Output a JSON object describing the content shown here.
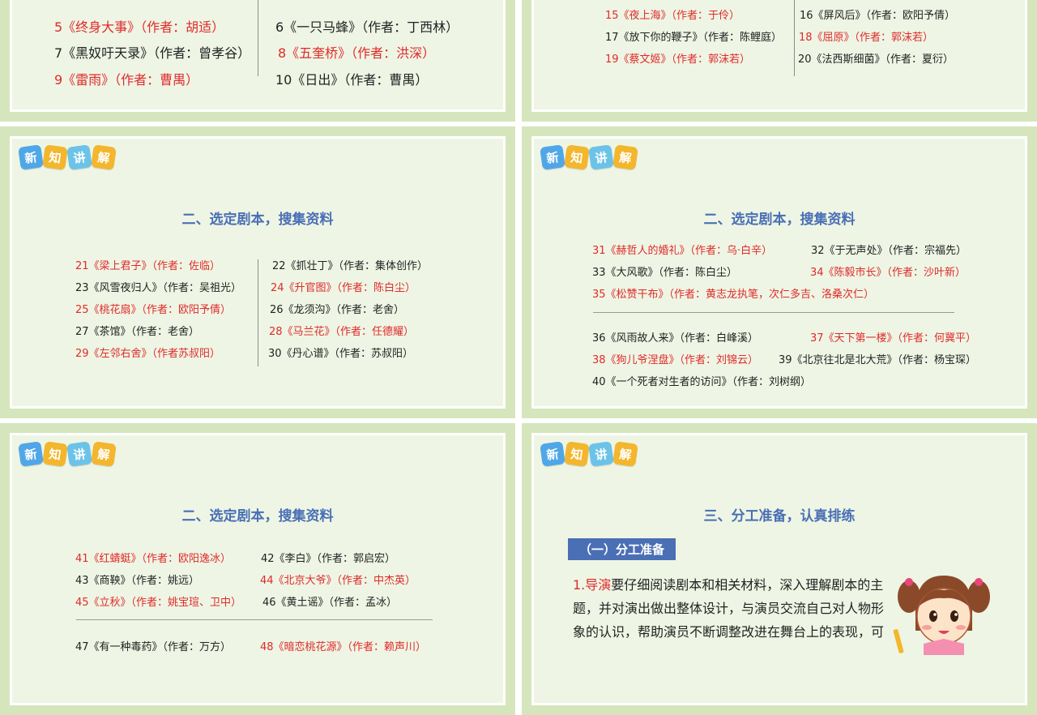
{
  "badge": {
    "chars": [
      "新",
      "知",
      "讲",
      "解"
    ],
    "colors": [
      "#4fa7e8",
      "#f3b62c",
      "#6cc3e8",
      "#f3b62c"
    ]
  },
  "slide1": {
    "left": [
      {
        "text": "5《终身大事》（作者：胡适）",
        "red": true
      },
      {
        "text": "7《黑奴吁天录》（作者：曾孝谷）",
        "red": false
      },
      {
        "text": "9《雷雨》（作者：曹禺）",
        "red": true
      }
    ],
    "right": [
      {
        "text": "6《一只马蜂》（作者：丁西林）",
        "red": false
      },
      {
        "text": "8《五奎桥》（作者：洪深）",
        "red": true
      },
      {
        "text": "10《日出》（作者：曹禺）",
        "red": false
      }
    ]
  },
  "slide2": {
    "left": [
      {
        "text": "15《夜上海》（作者：于伶）",
        "red": true
      },
      {
        "text": "17《放下你的鞭子》（作者：陈鲤庭）",
        "red": false
      },
      {
        "text": "19《蔡文姬》（作者：郭沫若）",
        "red": true
      }
    ],
    "right": [
      {
        "text": "16《屏风后》（作者：欧阳予倩）",
        "red": false
      },
      {
        "text": "18《屈原》（作者：郭沫若）",
        "red": true
      },
      {
        "text": "20《法西斯细菌》（作者：夏衍）",
        "red": false
      }
    ]
  },
  "slide3": {
    "title": "二、选定剧本，搜集资料",
    "left": [
      {
        "text": "21《梁上君子》（作者：佐临）",
        "red": true
      },
      {
        "text": "23《风雪夜归人》（作者：吴祖光）",
        "red": false
      },
      {
        "text": "25《桃花扇》（作者：欧阳予倩）",
        "red": true
      },
      {
        "text": "27《茶馆》（作者：老舍）",
        "red": false
      },
      {
        "text": "29《左邻右舍》（作者苏叔阳）",
        "red": true
      }
    ],
    "right": [
      {
        "text": "22《抓壮丁》（作者：集体创作）",
        "red": false
      },
      {
        "text": "24《升官图》（作者：陈白尘）",
        "red": true
      },
      {
        "text": "26《龙须沟》（作者：老舍）",
        "red": false
      },
      {
        "text": "28《马兰花》（作者：任德耀）",
        "red": true
      },
      {
        "text": "30《丹心谱》（作者：苏叔阳）",
        "red": false
      }
    ]
  },
  "slide4": {
    "title": "二、选定剧本，搜集资料",
    "r31": "31《赫哲人的婚礼》（作者：乌·白辛）",
    "r32": "32《于无声处》（作者：宗福先）",
    "r33": "33《大风歌》（作者：陈白尘）",
    "r34": "34《陈毅市长》（作者：沙叶新）",
    "r35": "35《松赞干布》（作者：黄志龙执笔，次仁多吉、洛桑次仁）",
    "r36": "36《风雨故人来》（作者：白峰溪）",
    "r37": "37《天下第一楼》（作者：何冀平）",
    "r38": "38《狗儿爷涅盘》（作者：刘锦云）",
    "r39": "39《北京往北是北大荒》（作者：杨宝琛）",
    "r40": "40《一个死者对生者的访问》（作者：刘树纲）"
  },
  "slide5": {
    "title": "二、选定剧本，搜集资料",
    "r41": "41《红蜻蜓》（作者：欧阳逸冰）",
    "r42": "42《李白》（作者：郭启宏）",
    "r43": "43《商鞅》（作者：姚远）",
    "r44": "44《北京大爷》（作者：中杰英）",
    "r45": "45《立秋》（作者：姚宝瑄、卫中）",
    "r46": "46《黄土谣》（作者：孟冰）",
    "r47": "47《有一种毒药》（作者：万方）",
    "r48": "48《暗恋桃花源》（作者：赖声川）"
  },
  "slide6": {
    "title": "三、分工准备，认真排练",
    "subhead": "（一）分工准备",
    "lead": "1.导演",
    "line1": "要仔细阅读剧本和相关材料，深入理解剧本的主",
    "line2": "题，并对演出做出整体设计，与演员交流自己对人物形",
    "line3": "象的认识，帮助演员不断调整改进在舞台上的表现，可"
  }
}
